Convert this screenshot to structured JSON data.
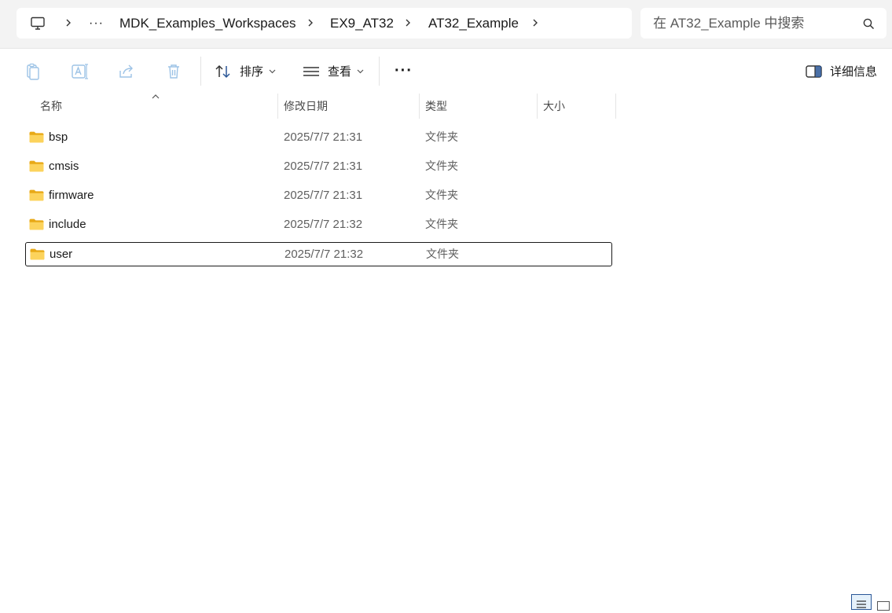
{
  "breadcrumb": {
    "more": "···",
    "items": [
      "MDK_Examples_Workspaces",
      "EX9_AT32",
      "AT32_Example"
    ]
  },
  "search": {
    "placeholder": "在 AT32_Example 中搜索"
  },
  "toolbar": {
    "sort_label": "排序",
    "view_label": "查看",
    "more_label": "···",
    "details_label": "详细信息"
  },
  "columns": {
    "name": "名称",
    "date": "修改日期",
    "type": "类型",
    "size": "大小"
  },
  "files": [
    {
      "name": "bsp",
      "date": "2025/7/7 21:31",
      "type": "文件夹",
      "size": ""
    },
    {
      "name": "cmsis",
      "date": "2025/7/7 21:31",
      "type": "文件夹",
      "size": ""
    },
    {
      "name": "firmware",
      "date": "2025/7/7 21:31",
      "type": "文件夹",
      "size": ""
    },
    {
      "name": "include",
      "date": "2025/7/7 21:32",
      "type": "文件夹",
      "size": ""
    },
    {
      "name": "user",
      "date": "2025/7/7 21:32",
      "type": "文件夹",
      "size": ""
    }
  ],
  "selected_file": "user",
  "icons": {
    "pc": "monitor-icon",
    "chevron": "chevron-right-icon",
    "search": "search-icon",
    "copy": "copy-icon",
    "rename": "rename-icon",
    "share": "share-icon",
    "delete": "trash-icon",
    "sort": "sort-arrows-icon",
    "view": "list-view-icon",
    "details": "details-pane-icon",
    "folder": "folder-icon"
  },
  "colors": {
    "folder": "#f7c948",
    "selection_border": "#1a1a1a",
    "chrome": "#f3f3f3",
    "disabled_icon": "#9dc3e6"
  }
}
